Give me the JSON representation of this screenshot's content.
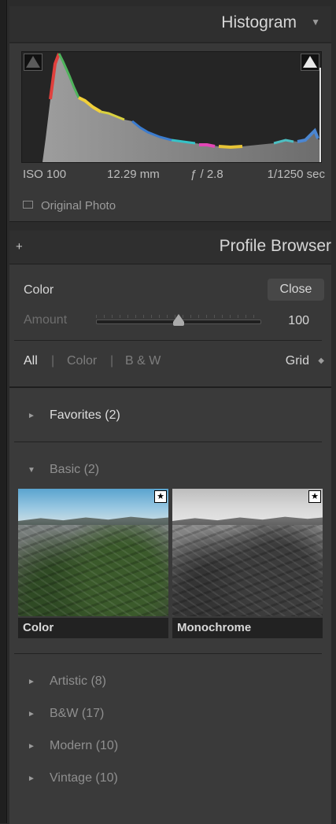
{
  "histogram": {
    "title": "Histogram",
    "exif": {
      "iso": "ISO 100",
      "focal_length": "12.29 mm",
      "aperture": "ƒ / 2.8",
      "shutter": "1/1250 sec"
    },
    "original_photo_label": "Original Photo",
    "original_photo_checked": false
  },
  "profile_browser": {
    "title": "Profile Browser",
    "profile_name": "Color",
    "close_label": "Close",
    "amount_label": "Amount",
    "amount_value": "100",
    "filters": {
      "all": "All",
      "separator": "|",
      "color": "Color",
      "bw": "B & W",
      "active": "All"
    },
    "view_mode": "Grid",
    "groups": {
      "favorites": "Favorites (2)",
      "basic": "Basic (2)",
      "artistic": "Artistic (8)",
      "bw": "B&W (17)",
      "modern": "Modern (10)",
      "vintage": "Vintage (10)"
    },
    "basic_profiles": [
      {
        "name": "Color",
        "favorite": true
      },
      {
        "name": "Monochrome",
        "favorite": true
      }
    ]
  },
  "icons": {
    "collapse": "▼",
    "plus": "+",
    "arrow_right": "►",
    "arrow_down": "▼",
    "updown": "◆",
    "star": "★"
  },
  "colors": {
    "panel": "#383838",
    "header": "#2f2f2f",
    "accent_text": "#d6d6d6"
  }
}
